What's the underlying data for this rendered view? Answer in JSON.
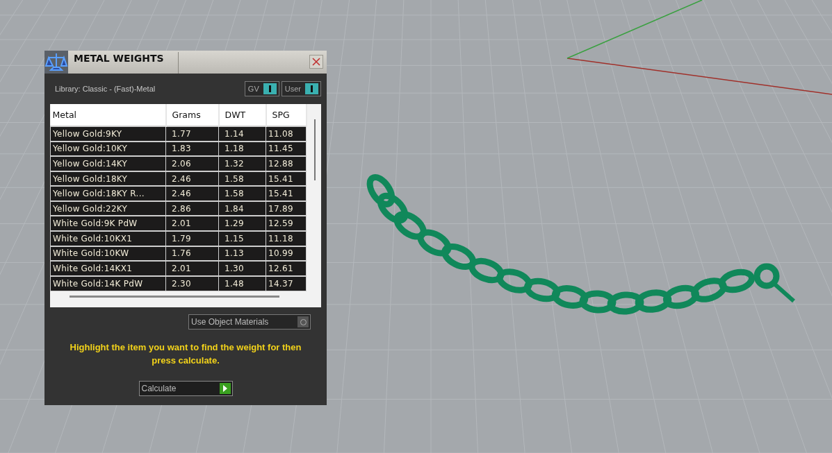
{
  "dialog": {
    "title": "METAL WEIGHTS",
    "library": "Library: Classic - (Fast)-Metal",
    "toggles": [
      {
        "label": "GV",
        "on": true
      },
      {
        "label": "User",
        "on": true
      }
    ],
    "table": {
      "columns": [
        "Metal",
        "Grams",
        "DWT",
        "SPG"
      ],
      "rows": [
        [
          "Yellow Gold:9KY",
          "1.77",
          "1.14",
          "11.08"
        ],
        [
          "Yellow Gold:10KY",
          "1.83",
          "1.18",
          "11.45"
        ],
        [
          "Yellow Gold:14KY",
          "2.06",
          "1.32",
          "12.88"
        ],
        [
          "Yellow Gold:18KY",
          "2.46",
          "1.58",
          "15.41"
        ],
        [
          "Yellow Gold:18KY R...",
          "2.46",
          "1.58",
          "15.41"
        ],
        [
          "Yellow Gold:22KY",
          "2.86",
          "1.84",
          "17.89"
        ],
        [
          "White Gold:9K PdW",
          "2.01",
          "1.29",
          "12.59"
        ],
        [
          "White Gold:10KX1",
          "1.79",
          "1.15",
          "11.18"
        ],
        [
          "White Gold:10KW",
          "1.76",
          "1.13",
          "10.99"
        ],
        [
          "White Gold:14KX1",
          "2.01",
          "1.30",
          "12.61"
        ],
        [
          "White Gold:14K PdW",
          "2.30",
          "1.48",
          "14.37"
        ]
      ]
    },
    "option": {
      "label": "Use Object Materials",
      "on": false
    },
    "hint": "Highlight the item you want to find the weight for then press calculate.",
    "button": "Calculate"
  }
}
